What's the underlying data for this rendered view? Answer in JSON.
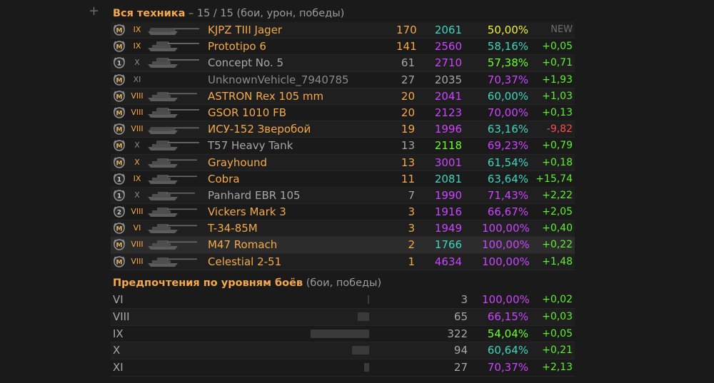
{
  "header": {
    "title": "Вся техника",
    "rest": "– 15 / 15 (бои, урон, победы)"
  },
  "colors": {
    "gold": "#f5a94a",
    "white": "#a6a6a6",
    "grey": "#8a8a8a",
    "red": "#ff4d4d",
    "green": "#61ef30",
    "lime": "#6bff2a",
    "yellow": "#f2f230",
    "teal": "#3fd5c0",
    "violet": "#cc44ff"
  },
  "vehicles": [
    {
      "mark": "M",
      "tier": "IX",
      "name": "KJPZ TIII Jager",
      "name_color": "gold",
      "battles": "170",
      "battles_color": "gold",
      "damage": "2061",
      "damage_color": "teal",
      "winrate": "50,00%",
      "winrate_color": "yellow",
      "delta": "NEW",
      "delta_color": "new",
      "tank_icon": "tank-destroyer-icon"
    },
    {
      "mark": "M",
      "tier": "IX",
      "name": "Prototipo 6",
      "name_color": "gold",
      "battles": "141",
      "battles_color": "gold",
      "damage": "2560",
      "damage_color": "violet",
      "winrate": "58,16%",
      "winrate_color": "teal",
      "delta": "+0,05",
      "delta_color": "green",
      "tank_icon": "heavy-tank-icon"
    },
    {
      "mark": "1",
      "tier": "X",
      "name": "Concept No. 5",
      "name_color": "white",
      "battles": "61",
      "battles_color": "white",
      "damage": "2710",
      "damage_color": "violet",
      "winrate": "57,38%",
      "winrate_color": "lime",
      "delta": "+0,71",
      "delta_color": "green",
      "tank_icon": "heavy-tank-icon"
    },
    {
      "mark": "M",
      "tier": "XI",
      "name": "UnknownVehicle_7940785",
      "name_color": "grey",
      "battles": "27",
      "battles_color": "white",
      "damage": "2035",
      "damage_color": "white",
      "winrate": "70,37%",
      "winrate_color": "violet",
      "delta": "+1,93",
      "delta_color": "green",
      "tank_icon": ""
    },
    {
      "mark": "M",
      "tier": "VIII",
      "name": "ASTRON Rex 105 mm",
      "name_color": "gold",
      "battles": "20",
      "battles_color": "gold",
      "damage": "2041",
      "damage_color": "violet",
      "winrate": "60,00%",
      "winrate_color": "teal",
      "delta": "+1,03",
      "delta_color": "green",
      "tank_icon": "medium-tank-icon"
    },
    {
      "mark": "M",
      "tier": "VIII",
      "name": "GSOR 1010 FB",
      "name_color": "gold",
      "battles": "20",
      "battles_color": "gold",
      "damage": "2123",
      "damage_color": "violet",
      "winrate": "70,00%",
      "winrate_color": "violet",
      "delta": "+0,13",
      "delta_color": "green",
      "tank_icon": "heavy-tank-icon"
    },
    {
      "mark": "M",
      "tier": "VIII",
      "name": "ИСУ-152 Зверобой",
      "name_color": "gold",
      "battles": "19",
      "battles_color": "gold",
      "damage": "1996",
      "damage_color": "violet",
      "winrate": "63,16%",
      "winrate_color": "teal",
      "delta": "-9,82",
      "delta_color": "red",
      "tank_icon": "tank-destroyer-icon"
    },
    {
      "mark": "M",
      "tier": "X",
      "name": "T57 Heavy Tank",
      "name_color": "white",
      "battles": "13",
      "battles_color": "white",
      "damage": "2118",
      "damage_color": "lime",
      "winrate": "69,23%",
      "winrate_color": "violet",
      "delta": "+0,79",
      "delta_color": "green",
      "tank_icon": "heavy-tank-icon"
    },
    {
      "mark": "M",
      "tier": "X",
      "name": "Grayhound",
      "name_color": "gold",
      "battles": "13",
      "battles_color": "gold",
      "damage": "3001",
      "damage_color": "violet",
      "winrate": "61,54%",
      "winrate_color": "teal",
      "delta": "+0,18",
      "delta_color": "green",
      "tank_icon": "medium-tank-icon"
    },
    {
      "mark": "1",
      "tier": "IX",
      "name": "Cobra",
      "name_color": "gold",
      "battles": "11",
      "battles_color": "gold",
      "damage": "2081",
      "damage_color": "teal",
      "winrate": "63,64%",
      "winrate_color": "teal",
      "delta": "+15,74",
      "delta_color": "green",
      "tank_icon": "medium-tank-icon"
    },
    {
      "mark": "1",
      "tier": "X",
      "name": "Panhard EBR 105",
      "name_color": "white",
      "battles": "7",
      "battles_color": "white",
      "damage": "1990",
      "damage_color": "violet",
      "winrate": "71,43%",
      "winrate_color": "violet",
      "delta": "+2,22",
      "delta_color": "green",
      "tank_icon": "light-tank-icon"
    },
    {
      "mark": "2",
      "tier": "VIII",
      "name": "Vickers Mark 3",
      "name_color": "gold",
      "battles": "3",
      "battles_color": "gold",
      "damage": "1916",
      "damage_color": "violet",
      "winrate": "66,67%",
      "winrate_color": "violet",
      "delta": "+2,05",
      "delta_color": "green",
      "tank_icon": "medium-tank-icon"
    },
    {
      "mark": "M",
      "tier": "VI",
      "name": "T-34-85M",
      "name_color": "gold",
      "battles": "3",
      "battles_color": "gold",
      "damage": "1949",
      "damage_color": "violet",
      "winrate": "100,00%",
      "winrate_color": "violet",
      "delta": "+0,40",
      "delta_color": "green",
      "tank_icon": "medium-tank-icon"
    },
    {
      "mark": "M",
      "tier": "VIII",
      "name": "M47 Romach",
      "name_color": "gold",
      "battles": "2",
      "battles_color": "gold",
      "damage": "1766",
      "damage_color": "teal",
      "winrate": "100,00%",
      "winrate_color": "violet",
      "delta": "+0,22",
      "delta_color": "green",
      "tank_icon": "medium-tank-icon"
    },
    {
      "mark": "M",
      "tier": "VIII",
      "name": "Celestial 2-51",
      "name_color": "gold",
      "battles": "1",
      "battles_color": "gold",
      "damage": "4634",
      "damage_color": "violet",
      "winrate": "100,00%",
      "winrate_color": "violet",
      "delta": "+1,48",
      "delta_color": "green",
      "tank_icon": "medium-tank-icon"
    }
  ],
  "preferences": {
    "title": "Предпочтения по уровням боёв",
    "rest": "(бои, победы)",
    "rows": [
      {
        "level": "VI",
        "battles": "3",
        "share": 0.01,
        "winrate": "100,00%",
        "winrate_color": "violet",
        "delta": "+0,02"
      },
      {
        "level": "VIII",
        "battles": "65",
        "share": 0.2,
        "winrate": "66,15%",
        "winrate_color": "violet",
        "delta": "+0,03"
      },
      {
        "level": "IX",
        "battles": "322",
        "share": 1.0,
        "winrate": "54,04%",
        "winrate_color": "lime",
        "delta": "+0,05"
      },
      {
        "level": "X",
        "battles": "94",
        "share": 0.29,
        "winrate": "60,64%",
        "winrate_color": "teal",
        "delta": "+0,21"
      },
      {
        "level": "XI",
        "battles": "27",
        "share": 0.08,
        "winrate": "70,37%",
        "winrate_color": "violet",
        "delta": "+2,13"
      }
    ]
  }
}
